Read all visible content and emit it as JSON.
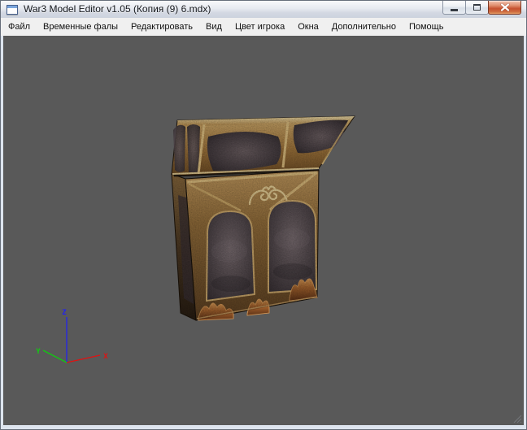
{
  "window": {
    "title": "War3 Model Editor v1.05 (Копия (9) 6.mdx)"
  },
  "menu": {
    "items": [
      "Файл",
      "Временные фалы",
      "Редактировать",
      "Вид",
      "Цвет игрока",
      "Окна",
      "Дополнительно",
      "Помощь"
    ]
  },
  "viewport": {
    "background_color": "#595959",
    "model": {
      "description": "ornate gold-trimmed chest model with dark arched panels",
      "gold_trim_color": "#c79a57",
      "panel_color": "#4a4045"
    },
    "axes": {
      "x": {
        "label": "X",
        "color": "#e01212"
      },
      "y": {
        "label": "Y",
        "color": "#12c812"
      },
      "z": {
        "label": "Z",
        "color": "#2424ec"
      }
    }
  }
}
